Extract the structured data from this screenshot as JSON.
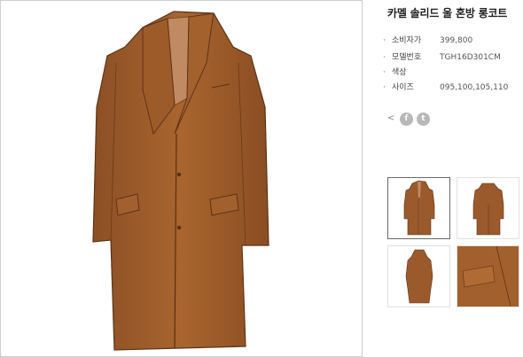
{
  "product": {
    "title": "카멜 솔리드 울 혼방 롱코트",
    "image_icon": "coat-image",
    "colors": {
      "coat": "#9a5a2c",
      "coat_dark": "#6e3d1c",
      "lining": "#c8906a"
    }
  },
  "specs": [
    {
      "label": "소비자가",
      "value": "399,800"
    },
    {
      "label": "모델번호",
      "value": "TGH16D301CM"
    },
    {
      "label": "색상",
      "value": ""
    },
    {
      "label": "사이즈",
      "value": "095,100,105,110"
    }
  ],
  "share": {
    "share_icon": "share-icon",
    "facebook_icon": "facebook-icon",
    "facebook_glyph": "f",
    "twitter_icon": "twitter-icon",
    "twitter_glyph": "t"
  },
  "thumbnails": [
    {
      "name": "front",
      "active": true
    },
    {
      "name": "back",
      "active": false
    },
    {
      "name": "side",
      "active": false
    },
    {
      "name": "detail",
      "active": false
    }
  ]
}
